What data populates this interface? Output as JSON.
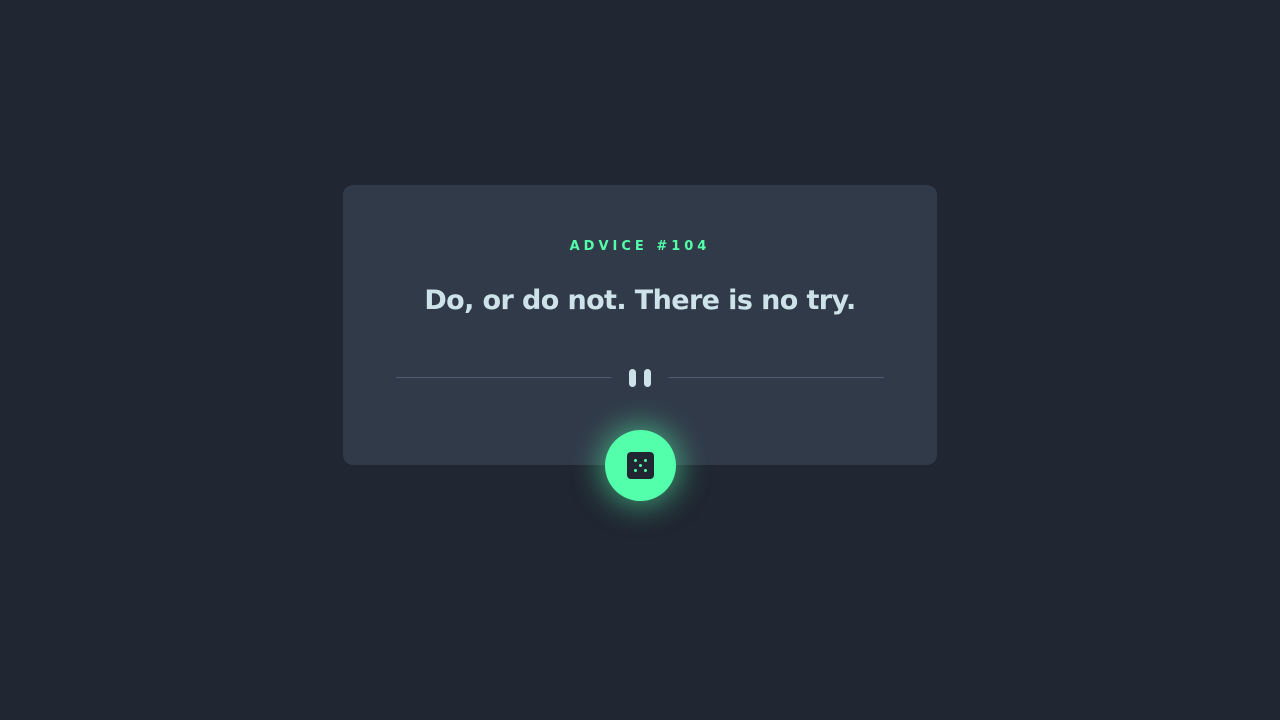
{
  "advice": {
    "id_label": "ADVICE #104",
    "quote": "Do, or do not. There is no try."
  },
  "divider": {
    "icon": "pause-icon"
  },
  "button": {
    "icon": "dice-icon",
    "aria_label": "Get new advice"
  },
  "colors": {
    "background": "#202632",
    "card": "#313a49",
    "accent": "#53ffaa",
    "text": "#cee3e9",
    "divider": "#4f5d74"
  }
}
